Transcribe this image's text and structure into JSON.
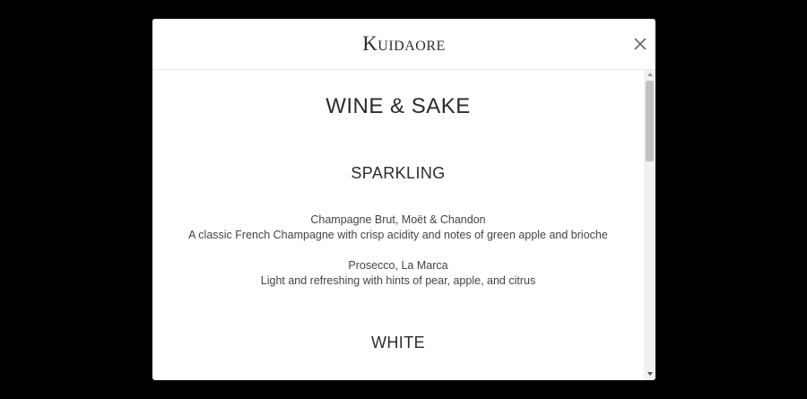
{
  "brand": {
    "name": "Kuidaore"
  },
  "menu": {
    "title": "WINE & SAKE",
    "sections": [
      {
        "title": "SPARKLING",
        "items": [
          {
            "name": "Champagne Brut, Moët & Chandon",
            "description": "A classic French Champagne with crisp acidity and notes of green apple and brioche"
          },
          {
            "name": "Prosecco, La Marca",
            "description": "Light and refreshing with hints of pear, apple, and citrus"
          }
        ]
      },
      {
        "title": "WHITE",
        "items": []
      }
    ]
  },
  "icons": {
    "close": "close-icon",
    "scroll_up": "chevron-up-icon",
    "scroll_down": "chevron-down-icon"
  },
  "colors": {
    "backdrop": "#000000",
    "modal_background": "#ffffff",
    "text": "#3a3a3a",
    "scrollbar_thumb": "#c1c1c1"
  }
}
